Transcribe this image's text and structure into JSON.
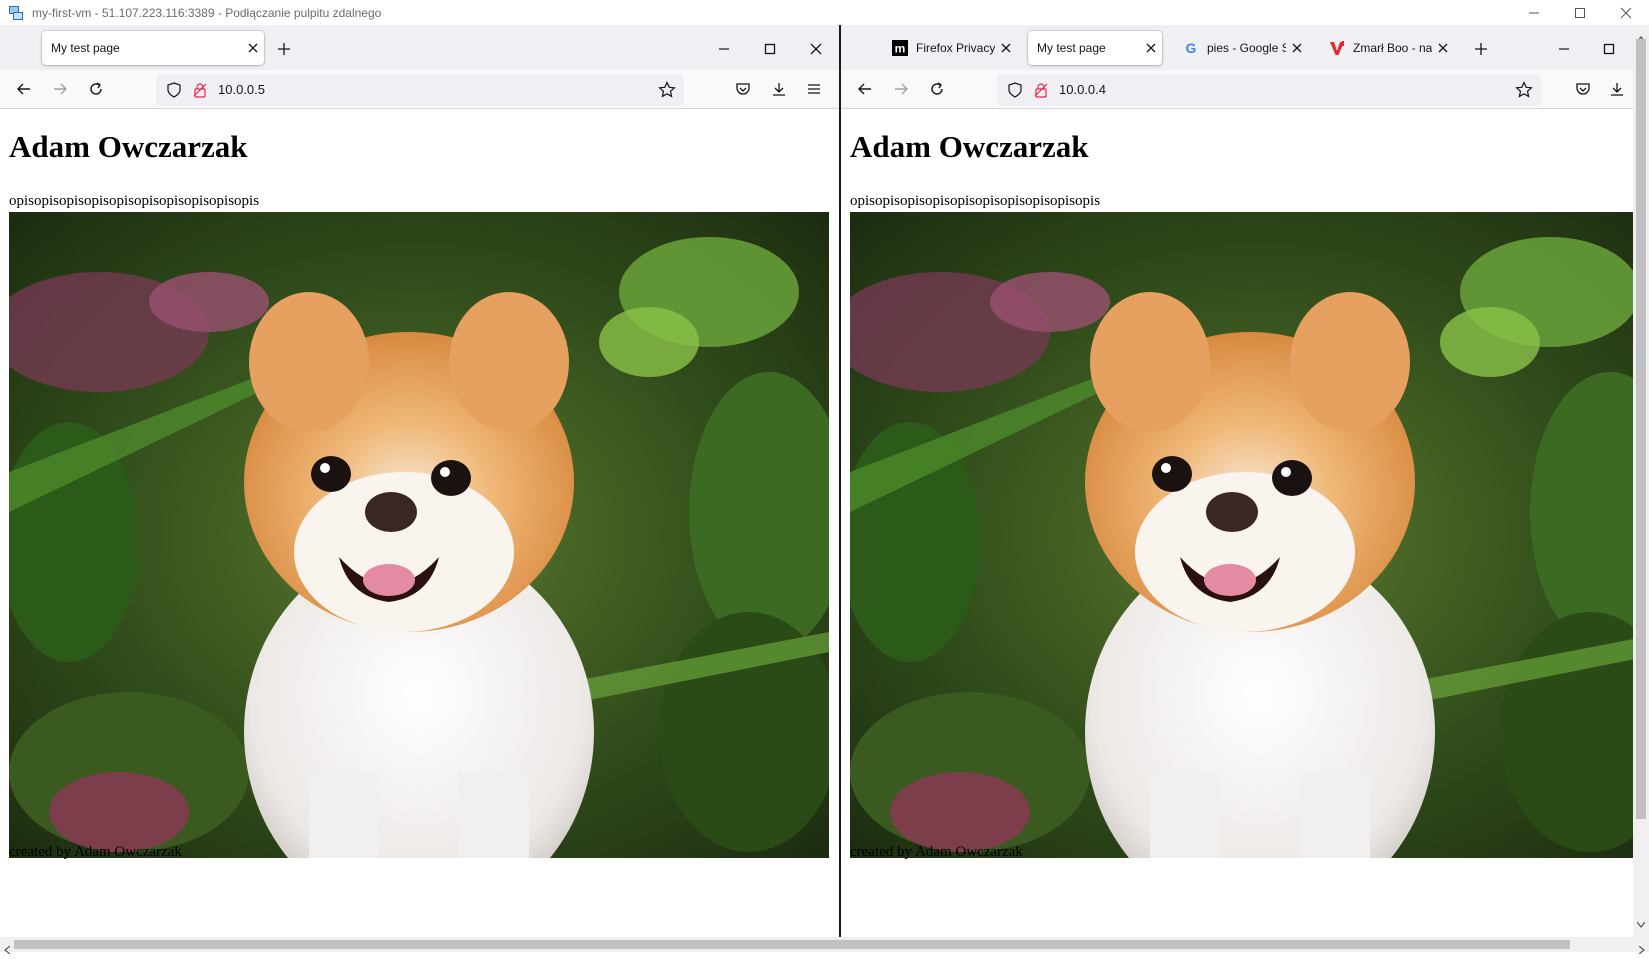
{
  "rdp_window": {
    "title": "my-first-vm - 51.107.223.116:3389 - Podłączanie pulpitu zdalnego"
  },
  "left_browser": {
    "tabs": [
      {
        "label": "My test page",
        "active": true
      }
    ],
    "url": "10.0.0.5",
    "page": {
      "heading": "Adam Owczarzak",
      "description": "opisopisopisopisopisopisopisopisopisopis",
      "footer": "created by Adam Owczarzak"
    }
  },
  "right_browser": {
    "tabs": [
      {
        "label": "Firefox Privacy N",
        "active": false,
        "icon": "mozilla-icon"
      },
      {
        "label": "My test page",
        "active": true
      },
      {
        "label": "pies - Google Se",
        "active": false,
        "icon": "google-icon"
      },
      {
        "label": "Zmarł Boo - najp",
        "active": false,
        "icon": "wp-icon"
      }
    ],
    "url": "10.0.0.4",
    "page": {
      "heading": "Adam Owczarzak",
      "description": "opisopisopisopisopisopisopisopisopisopis",
      "footer": "created by Adam Owczarzak"
    }
  },
  "colors": {
    "tab_strip": "#f0f0f4",
    "toolbar": "#f9f9fb",
    "urlbar": "#f0f0f4",
    "google_blue": "#4285F4",
    "wp_red": "#e5292b"
  }
}
